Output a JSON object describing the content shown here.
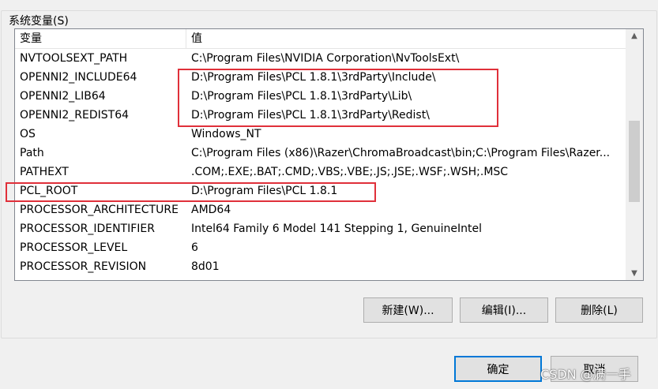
{
  "group": {
    "title": "系统变量(S)"
  },
  "list": {
    "columns": {
      "name": "变量",
      "value": "值"
    },
    "rows": [
      {
        "name": "NVTOOLSEXT_PATH",
        "value": "C:\\Program Files\\NVIDIA Corporation\\NvToolsExt\\"
      },
      {
        "name": "OPENNI2_INCLUDE64",
        "value": "D:\\Program Files\\PCL 1.8.1\\3rdParty\\Include\\"
      },
      {
        "name": "OPENNI2_LIB64",
        "value": "D:\\Program Files\\PCL 1.8.1\\3rdParty\\Lib\\"
      },
      {
        "name": "OPENNI2_REDIST64",
        "value": "D:\\Program Files\\PCL 1.8.1\\3rdParty\\Redist\\"
      },
      {
        "name": "OS",
        "value": "Windows_NT"
      },
      {
        "name": "Path",
        "value": "C:\\Program Files (x86)\\Razer\\ChromaBroadcast\\bin;C:\\Program Files\\Razer..."
      },
      {
        "name": "PATHEXT",
        "value": ".COM;.EXE;.BAT;.CMD;.VBS;.VBE;.JS;.JSE;.WSF;.WSH;.MSC"
      },
      {
        "name": "PCL_ROOT",
        "value": "D:\\Program Files\\PCL 1.8.1"
      },
      {
        "name": "PROCESSOR_ARCHITECTURE",
        "value": "AMD64"
      },
      {
        "name": "PROCESSOR_IDENTIFIER",
        "value": "Intel64 Family 6 Model 141 Stepping 1, GenuineIntel"
      },
      {
        "name": "PROCESSOR_LEVEL",
        "value": "6"
      },
      {
        "name": "PROCESSOR_REVISION",
        "value": "8d01"
      }
    ]
  },
  "buttons": {
    "new": "新建(W)...",
    "edit": "编辑(I)...",
    "delete": "删除(L)",
    "ok": "确定",
    "cancel": "取消"
  },
  "watermark": "CSDN @满一手",
  "colors": {
    "highlight": "#e0303a",
    "default_button_border": "#0078d7"
  }
}
